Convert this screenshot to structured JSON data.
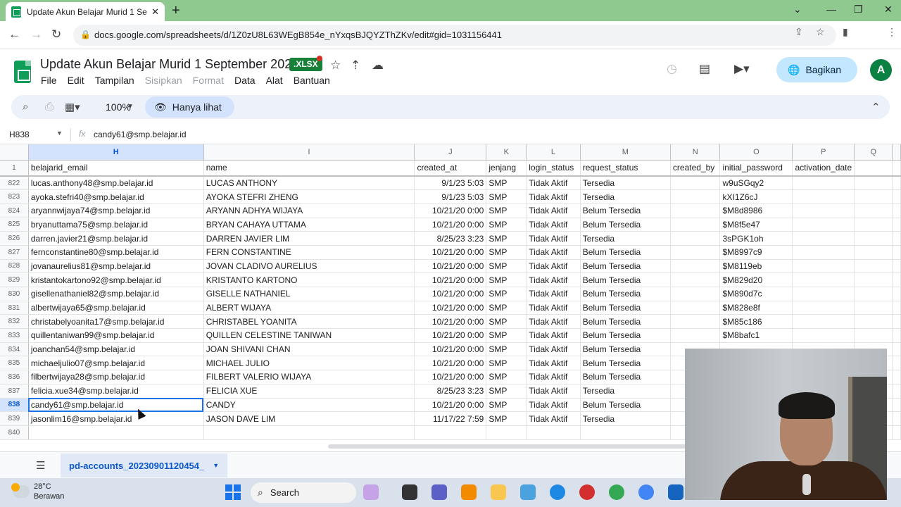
{
  "browser": {
    "tab_title": "Update Akun Belajar Murid 1 Sep",
    "url": "docs.google.com/spreadsheets/d/1Z0zU8L63WEgB854e_nYxqsBJQYZThZKv/edit#gid=1031156441",
    "profile_initial": "A"
  },
  "doc": {
    "title": "Update Akun Belajar Murid 1 September 2023",
    "badge": ".XLSX",
    "share_label": "Bagikan",
    "profile_initial": "A"
  },
  "menu": {
    "file": "File",
    "edit": "Edit",
    "view": "Tampilan",
    "insert": "Sisipkan",
    "format": "Format",
    "data": "Data",
    "tools": "Alat",
    "help": "Bantuan"
  },
  "toolbar": {
    "zoom": "100%",
    "view_only": "Hanya lihat"
  },
  "formula_bar": {
    "cell_ref": "H838",
    "fx": "fx",
    "value": "candy61@smp.belajar.id"
  },
  "columns": [
    "H",
    "I",
    "J",
    "K",
    "L",
    "M",
    "N",
    "O",
    "P",
    "Q"
  ],
  "header_row": {
    "num": "1",
    "cells": [
      "belajarid_email",
      "name",
      "created_at",
      "jenjang",
      "login_status",
      "request_status",
      "created_by",
      "initial_password",
      "activation_date",
      ""
    ]
  },
  "rows": [
    {
      "num": "822",
      "email": "lucas.anthony48@smp.belajar.id",
      "name": "LUCAS ANTHONY",
      "created_at": "9/1/23 5:03",
      "jenjang": "SMP",
      "login": "Tidak Aktif",
      "request": "Tersedia",
      "pw": "w9uSGqy2"
    },
    {
      "num": "823",
      "email": "ayoka.stefri40@smp.belajar.id",
      "name": "AYOKA STEFRI ZHENG",
      "created_at": "9/1/23 5:03",
      "jenjang": "SMP",
      "login": "Tidak Aktif",
      "request": "Tersedia",
      "pw": "kXI1Z6cJ"
    },
    {
      "num": "824",
      "email": "aryannwijaya74@smp.belajar.id",
      "name": "ARYANN ADHYA WIJAYA",
      "created_at": "10/21/20 0:00",
      "jenjang": "SMP",
      "login": "Tidak Aktif",
      "request": "Belum Tersedia",
      "pw": "$M8d8986"
    },
    {
      "num": "825",
      "email": "bryanuttama75@smp.belajar.id",
      "name": "BRYAN CAHAYA UTTAMA",
      "created_at": "10/21/20 0:00",
      "jenjang": "SMP",
      "login": "Tidak Aktif",
      "request": "Belum Tersedia",
      "pw": "$M8f5e47"
    },
    {
      "num": "826",
      "email": "darren.javier21@smp.belajar.id",
      "name": "DARREN JAVIER LIM",
      "created_at": "8/25/23 3:23",
      "jenjang": "SMP",
      "login": "Tidak Aktif",
      "request": "Tersedia",
      "pw": "3sPGK1oh"
    },
    {
      "num": "827",
      "email": "fernconstantine80@smp.belajar.id",
      "name": "FERN CONSTANTINE",
      "created_at": "10/21/20 0:00",
      "jenjang": "SMP",
      "login": "Tidak Aktif",
      "request": "Belum Tersedia",
      "pw": "$M8997c9"
    },
    {
      "num": "828",
      "email": "jovanaurelius81@smp.belajar.id",
      "name": "JOVAN CLADIVO AURELIUS",
      "created_at": "10/21/20 0:00",
      "jenjang": "SMP",
      "login": "Tidak Aktif",
      "request": "Belum Tersedia",
      "pw": "$M8119eb"
    },
    {
      "num": "829",
      "email": "kristantokartono92@smp.belajar.id",
      "name": "KRISTANTO KARTONO",
      "created_at": "10/21/20 0:00",
      "jenjang": "SMP",
      "login": "Tidak Aktif",
      "request": "Belum Tersedia",
      "pw": "$M829d20"
    },
    {
      "num": "830",
      "email": "gisellenathaniel82@smp.belajar.id",
      "name": "GISELLE NATHANIEL",
      "created_at": "10/21/20 0:00",
      "jenjang": "SMP",
      "login": "Tidak Aktif",
      "request": "Belum Tersedia",
      "pw": "$M890d7c"
    },
    {
      "num": "831",
      "email": "albertwijaya65@smp.belajar.id",
      "name": "ALBERT WIJAYA",
      "created_at": "10/21/20 0:00",
      "jenjang": "SMP",
      "login": "Tidak Aktif",
      "request": "Belum Tersedia",
      "pw": "$M828e8f"
    },
    {
      "num": "832",
      "email": "christabelyoanita17@smp.belajar.id",
      "name": "CHRISTABEL YOANITA",
      "created_at": "10/21/20 0:00",
      "jenjang": "SMP",
      "login": "Tidak Aktif",
      "request": "Belum Tersedia",
      "pw": "$M85c186"
    },
    {
      "num": "833",
      "email": "quillentaniwan99@smp.belajar.id",
      "name": "QUILLEN CELESTINE TANIWAN",
      "created_at": "10/21/20 0:00",
      "jenjang": "SMP",
      "login": "Tidak Aktif",
      "request": "Belum Tersedia",
      "pw": "$M8bafc1"
    },
    {
      "num": "834",
      "email": "joanchan54@smp.belajar.id",
      "name": "JOAN SHIVANI CHAN",
      "created_at": "10/21/20 0:00",
      "jenjang": "SMP",
      "login": "Tidak Aktif",
      "request": "Belum Tersedia",
      "pw": ""
    },
    {
      "num": "835",
      "email": "michaeljulio07@smp.belajar.id",
      "name": "MICHAEL JULIO",
      "created_at": "10/21/20 0:00",
      "jenjang": "SMP",
      "login": "Tidak Aktif",
      "request": "Belum Tersedia",
      "pw": ""
    },
    {
      "num": "836",
      "email": "filbertwijaya28@smp.belajar.id",
      "name": "FILBERT VALERIO WIJAYA",
      "created_at": "10/21/20 0:00",
      "jenjang": "SMP",
      "login": "Tidak Aktif",
      "request": "Belum Tersedia",
      "pw": ""
    },
    {
      "num": "837",
      "email": "felicia.xue34@smp.belajar.id",
      "name": "FELICIA XUE",
      "created_at": "8/25/23 3:23",
      "jenjang": "SMP",
      "login": "Tidak Aktif",
      "request": "Tersedia",
      "pw": ""
    },
    {
      "num": "838",
      "email": "candy61@smp.belajar.id",
      "name": "CANDY",
      "created_at": "10/21/20 0:00",
      "jenjang": "SMP",
      "login": "Tidak Aktif",
      "request": "Belum Tersedia",
      "pw": ""
    },
    {
      "num": "839",
      "email": "jasonlim16@smp.belajar.id",
      "name": "JASON DAVE LIM",
      "created_at": "11/17/22 7:59",
      "jenjang": "SMP",
      "login": "Tidak Aktif",
      "request": "Tersedia",
      "pw": ""
    },
    {
      "num": "840",
      "email": "",
      "name": "",
      "created_at": "",
      "jenjang": "",
      "login": "",
      "request": "",
      "pw": ""
    }
  ],
  "sheet_tab": "pd-accounts_20230901120454_",
  "taskbar": {
    "temp": "28°C",
    "weather": "Berawan",
    "search": "Search"
  },
  "colors": {
    "accent": "#1a73e8",
    "sheets_green": "#0f9d58",
    "share_bg": "#c2e7ff",
    "selection": "#d3e3fd"
  }
}
